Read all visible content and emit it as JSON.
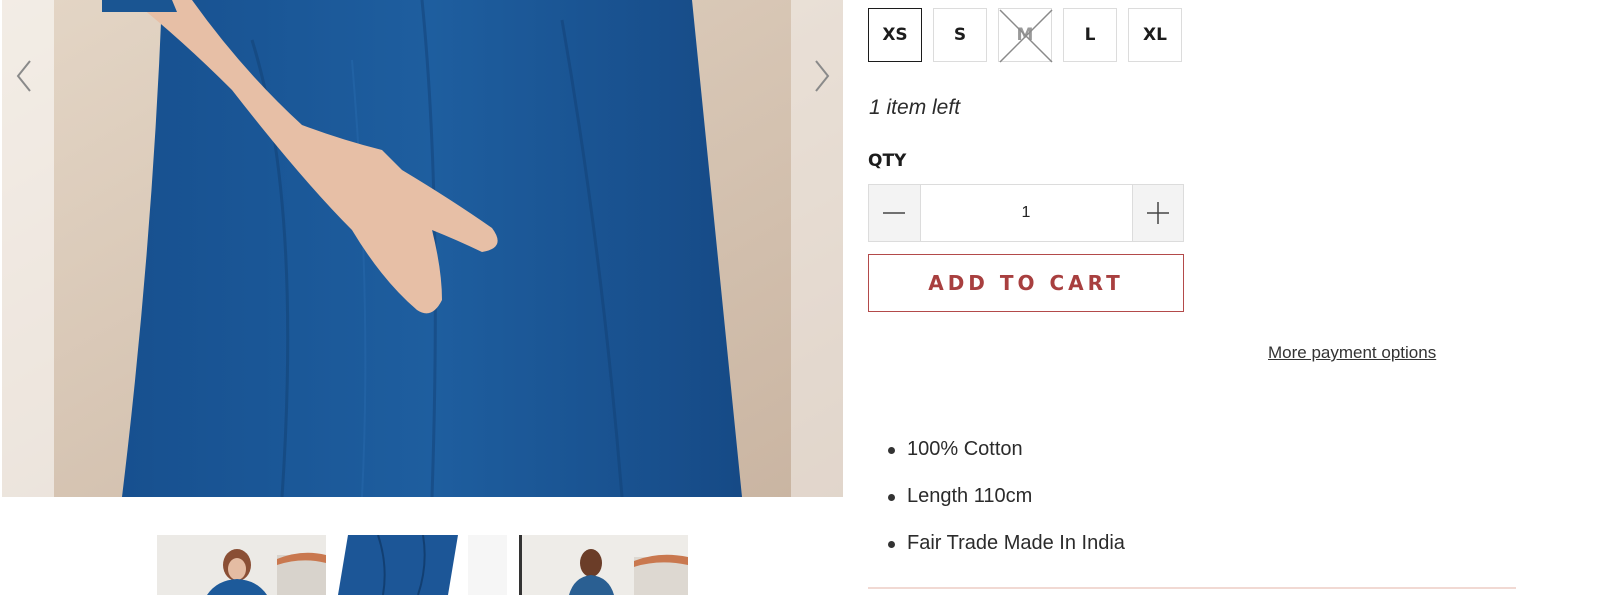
{
  "gallery": {
    "main_image": "Model in blue denim dress with hand in pocket",
    "prev_icon": "chevron-left-icon",
    "next_icon": "chevron-right-icon",
    "thumbnails": [
      "thumbnail-front-view",
      "thumbnail-detail-view",
      "thumbnail-back-view"
    ]
  },
  "product": {
    "sizes": [
      {
        "label": "XS",
        "selected": true,
        "available": true
      },
      {
        "label": "S",
        "selected": false,
        "available": true
      },
      {
        "label": "M",
        "selected": false,
        "available": false
      },
      {
        "label": "L",
        "selected": false,
        "available": true
      },
      {
        "label": "XL",
        "selected": false,
        "available": true
      }
    ],
    "stock_text": "1 item left",
    "qty_label": "QTY",
    "qty_value": "1",
    "add_to_cart": "ADD TO CART",
    "more_payment_options": "More payment options",
    "features": [
      "100% Cotton",
      "Length 110cm",
      "Fair Trade Made In India"
    ]
  },
  "colors": {
    "accent": "#a83f3f",
    "border": "#dcdcdc",
    "dress_blue": "#1f5a98"
  }
}
